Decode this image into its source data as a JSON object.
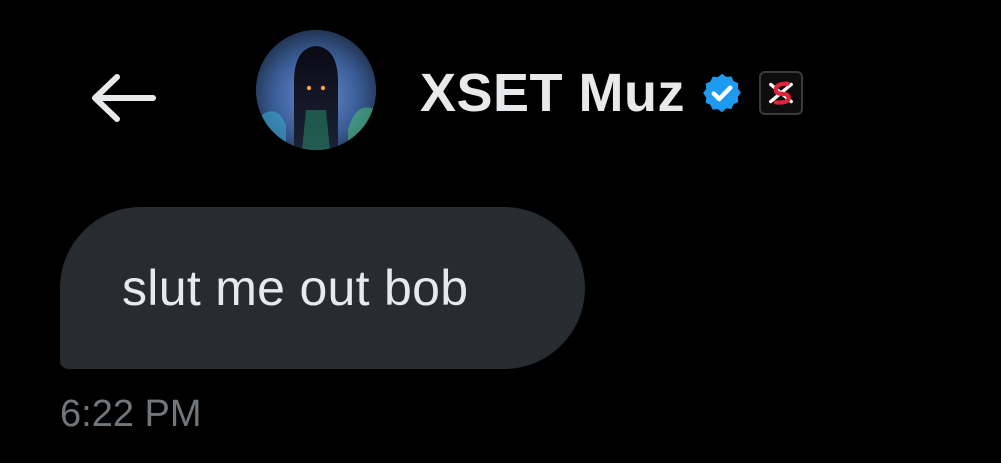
{
  "header": {
    "back_icon": "arrow-left-icon",
    "avatar_alt": "profile picture",
    "display_name": "XSET Muz",
    "verified_icon": "verified-badge-icon",
    "affiliate_icon": "xset-logo-icon",
    "accent_color": "#1d9bf0",
    "affiliate_color": "#e0243a"
  },
  "conversation": {
    "messages": [
      {
        "text": "slut me out bob",
        "time": "6:22 PM"
      }
    ]
  },
  "colors": {
    "background": "#000000",
    "bubble": "#272c30",
    "text": "#e7e9ea",
    "muted": "#71767b"
  }
}
